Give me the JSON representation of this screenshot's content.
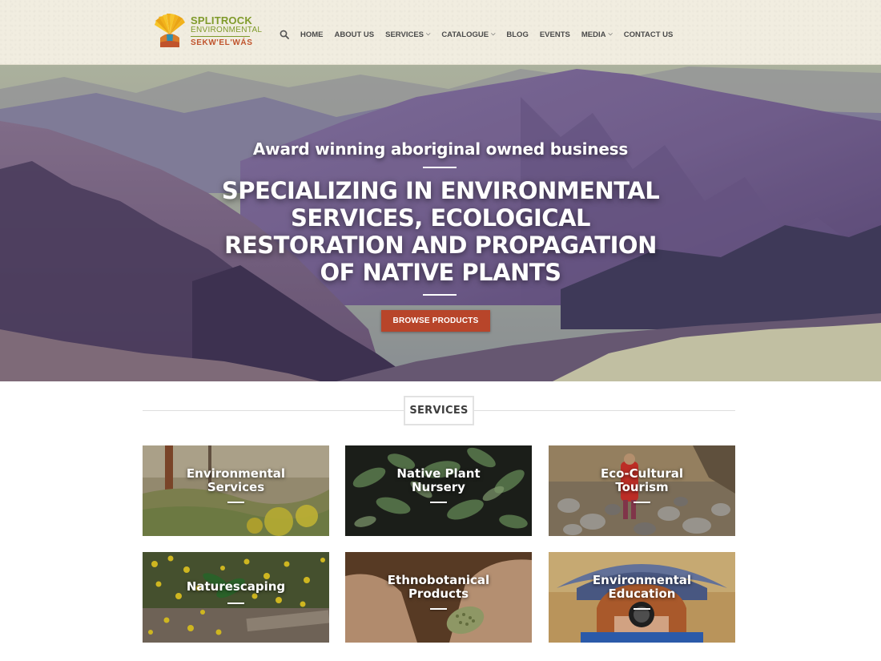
{
  "logo": {
    "line1": "SPLITROCK",
    "line2": "ENVIRONMENTAL",
    "line3": "SEKW'EL'WÁS"
  },
  "nav": {
    "search_icon": "search-icon",
    "items": [
      {
        "label": "HOME",
        "dropdown": false
      },
      {
        "label": "ABOUT US",
        "dropdown": false
      },
      {
        "label": "SERVICES",
        "dropdown": true
      },
      {
        "label": "CATALOGUE",
        "dropdown": true
      },
      {
        "label": "BLOG",
        "dropdown": false
      },
      {
        "label": "EVENTS",
        "dropdown": false
      },
      {
        "label": "MEDIA",
        "dropdown": true
      },
      {
        "label": "CONTACT US",
        "dropdown": false
      }
    ]
  },
  "hero": {
    "tagline": "Award winning aboriginal owned business",
    "headline": "SPECIALIZING IN ENVIRONMENTAL SERVICES, ECOLOGICAL RESTORATION AND PROPAGATION OF NATIVE PLANTS",
    "button_label": "BROWSE PRODUCTS"
  },
  "services": {
    "title": "SERVICES",
    "cards": [
      {
        "line1": "Environmental",
        "line2": "Services"
      },
      {
        "line1": "Native Plant",
        "line2": "Nursery"
      },
      {
        "line1": "Eco-Cultural",
        "line2": "Tourism"
      },
      {
        "line1": "Naturescaping",
        "line2": ""
      },
      {
        "line1": "Ethnobotanical",
        "line2": "Products"
      },
      {
        "line1": "Environmental",
        "line2": "Education"
      }
    ]
  },
  "colors": {
    "accent": "#b8452a",
    "logo_green": "#7f9a2a",
    "logo_red": "#c0532c",
    "header_bg": "#f1ede0"
  }
}
